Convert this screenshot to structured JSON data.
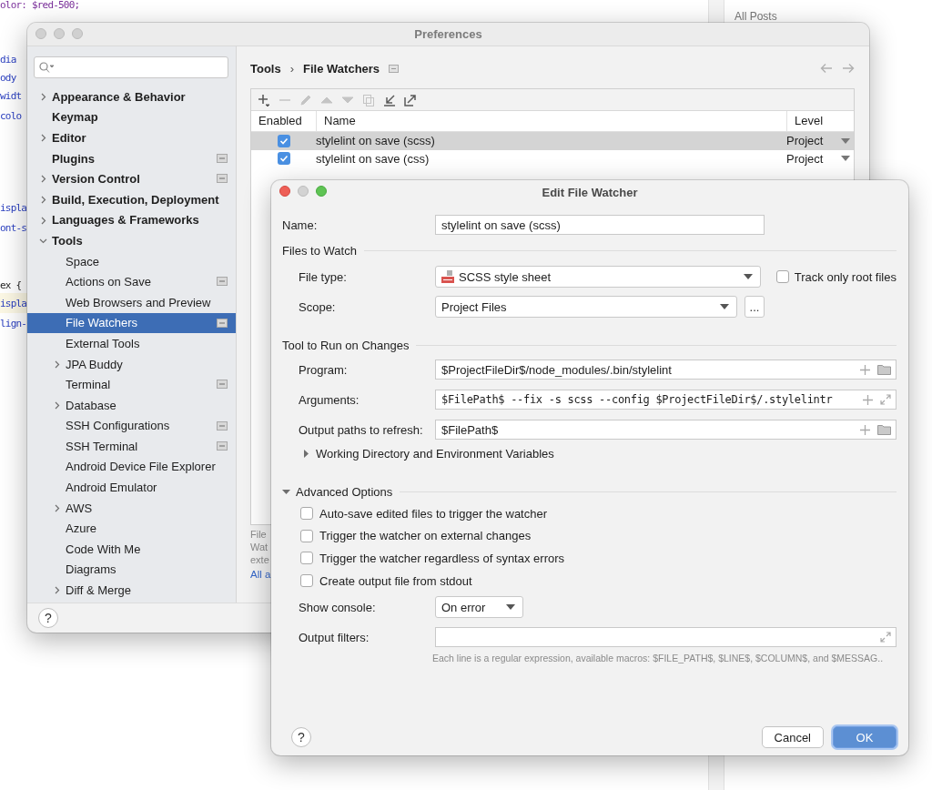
{
  "editor": {
    "code_lines": [
      {
        "text": "olor: $red-500;",
        "kind": "value"
      },
      {
        "text": "dia",
        "kind": "property"
      },
      {
        "text": "ody",
        "kind": "property"
      },
      {
        "text": "widt",
        "kind": "property"
      },
      {
        "text": "colo",
        "kind": "property"
      },
      {
        "text": "ispla",
        "kind": "property"
      },
      {
        "text": "ont-s",
        "kind": "property"
      },
      {
        "text": "ex {",
        "kind": "selector"
      },
      {
        "text": "ispla",
        "kind": "property"
      },
      {
        "text": "lign-",
        "kind": "property"
      }
    ],
    "side_panel": {
      "title": "All Posts"
    }
  },
  "preferences": {
    "title": "Preferences",
    "sidebar": {
      "items": [
        {
          "label": "Appearance & Behavior",
          "kind": "group",
          "expanded": false,
          "project_icon": false,
          "selected": false
        },
        {
          "label": "Keymap",
          "kind": "page",
          "project_icon": false,
          "selected": false
        },
        {
          "label": "Editor",
          "kind": "group",
          "expanded": false,
          "project_icon": false,
          "selected": false
        },
        {
          "label": "Plugins",
          "kind": "page",
          "project_icon": true,
          "selected": false
        },
        {
          "label": "Version Control",
          "kind": "group",
          "expanded": false,
          "project_icon": true,
          "selected": false
        },
        {
          "label": "Build, Execution, Deployment",
          "kind": "group",
          "expanded": false,
          "project_icon": false,
          "selected": false
        },
        {
          "label": "Languages & Frameworks",
          "kind": "group",
          "expanded": false,
          "project_icon": false,
          "selected": false
        },
        {
          "label": "Tools",
          "kind": "group",
          "expanded": true,
          "project_icon": false,
          "selected": false,
          "children": [
            {
              "label": "Space",
              "kind": "page",
              "project_icon": false,
              "selected": false
            },
            {
              "label": "Actions on Save",
              "kind": "page",
              "project_icon": true,
              "selected": false
            },
            {
              "label": "Web Browsers and Preview",
              "kind": "page",
              "project_icon": false,
              "selected": false
            },
            {
              "label": "File Watchers",
              "kind": "page",
              "project_icon": true,
              "selected": true
            },
            {
              "label": "External Tools",
              "kind": "page",
              "project_icon": false,
              "selected": false
            },
            {
              "label": "JPA Buddy",
              "kind": "group",
              "expanded": false,
              "project_icon": false,
              "selected": false
            },
            {
              "label": "Terminal",
              "kind": "page",
              "project_icon": true,
              "selected": false
            },
            {
              "label": "Database",
              "kind": "group",
              "expanded": false,
              "project_icon": false,
              "selected": false
            },
            {
              "label": "SSH Configurations",
              "kind": "page",
              "project_icon": true,
              "selected": false
            },
            {
              "label": "SSH Terminal",
              "kind": "page",
              "project_icon": true,
              "selected": false
            },
            {
              "label": "Android Device File Explorer",
              "kind": "page",
              "project_icon": false,
              "selected": false
            },
            {
              "label": "Android Emulator",
              "kind": "page",
              "project_icon": false,
              "selected": false
            },
            {
              "label": "AWS",
              "kind": "group",
              "expanded": false,
              "project_icon": false,
              "selected": false
            },
            {
              "label": "Azure",
              "kind": "page",
              "project_icon": false,
              "selected": false
            },
            {
              "label": "Code With Me",
              "kind": "page",
              "project_icon": false,
              "selected": false
            },
            {
              "label": "Diagrams",
              "kind": "page",
              "project_icon": false,
              "selected": false
            },
            {
              "label": "Diff & Merge",
              "kind": "group",
              "expanded": false,
              "project_icon": false,
              "selected": false
            }
          ]
        }
      ]
    },
    "breadcrumb": [
      "Tools",
      "File Watchers"
    ],
    "breadcrumb_separator": "›",
    "help": "?",
    "toolbar": [
      {
        "kind": "add",
        "disabled": false
      },
      {
        "kind": "remove",
        "disabled": true
      },
      {
        "kind": "edit",
        "disabled": true
      },
      {
        "kind": "up",
        "disabled": true
      },
      {
        "kind": "down",
        "disabled": true
      },
      {
        "kind": "copy",
        "disabled": true
      },
      {
        "kind": "import",
        "disabled": false
      },
      {
        "kind": "export",
        "disabled": false
      }
    ],
    "table": {
      "columns": [
        "Enabled",
        "Name",
        "Level"
      ],
      "rows": [
        {
          "enabled": true,
          "name": "stylelint on save (scss)",
          "level": "Project",
          "selected": true
        },
        {
          "enabled": true,
          "name": "stylelint on save (css)",
          "level": "Project",
          "selected": false
        }
      ]
    },
    "description_lines": [
      "File",
      "Wat",
      "exte"
    ],
    "link": "All a"
  },
  "dialog": {
    "title": "Edit File Watcher",
    "name": {
      "label": "Name:",
      "value": "stylelint on save (scss)"
    },
    "files_to_watch": {
      "title": "Files to Watch",
      "file_type": {
        "label": "File type:",
        "value": "SCSS style sheet"
      },
      "track_only_root": {
        "label": "Track only root files",
        "checked": false
      },
      "scope": {
        "label": "Scope:",
        "value": "Project Files",
        "browse": "..."
      }
    },
    "tool": {
      "title": "Tool to Run on Changes",
      "fields": [
        {
          "label": "Program:",
          "value": "$ProjectFileDir$/node_modules/.bin/stylelint",
          "kind": "path",
          "mono": false
        },
        {
          "label": "Arguments:",
          "value": "$FilePath$ --fix -s scss --config $ProjectFileDir$/.stylelintr",
          "kind": "args",
          "mono": true
        },
        {
          "label": "Output paths to refresh:",
          "value": "$FilePath$",
          "kind": "path",
          "mono": false
        }
      ],
      "working_dir": {
        "label": "Working Directory and Environment Variables",
        "expanded": false
      }
    },
    "advanced": {
      "title": "Advanced Options",
      "expanded": true,
      "options": [
        {
          "label": "Auto-save edited files to trigger the watcher",
          "checked": false
        },
        {
          "label": "Trigger the watcher on external changes",
          "checked": false
        },
        {
          "label": "Trigger the watcher regardless of syntax errors",
          "checked": false
        },
        {
          "label": "Create output file from stdout",
          "checked": false
        }
      ],
      "show_console": {
        "label": "Show console:",
        "value": "On error"
      },
      "output_filters": {
        "label": "Output filters:"
      },
      "hint": "Each line is a regular expression, available macros: $FILE_PATH$, $LINE$, $COLUMN$, and $MESSAG.."
    },
    "help": "?",
    "buttons": [
      {
        "label": "Cancel",
        "default": false
      },
      {
        "label": "OK",
        "default": true
      }
    ]
  }
}
